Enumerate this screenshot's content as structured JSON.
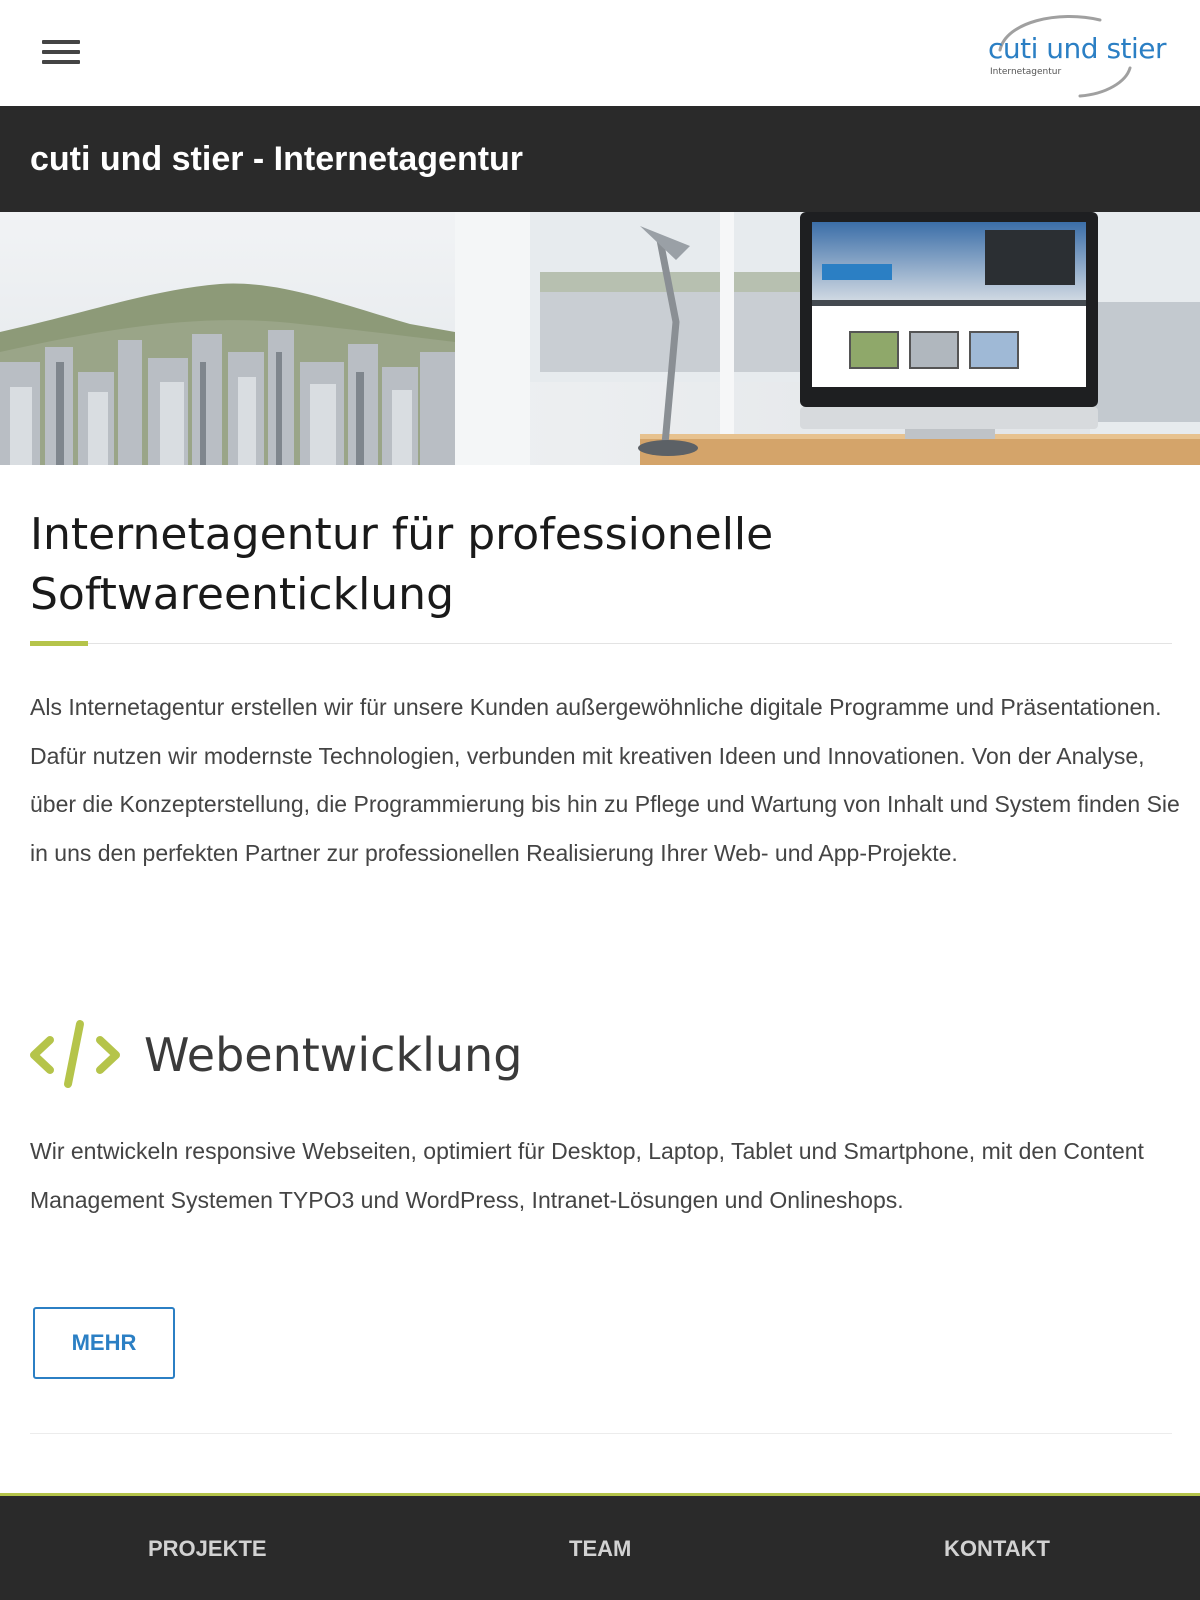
{
  "header": {
    "menu_icon": "hamburger-menu-icon",
    "logo": {
      "name": "cuti und stier",
      "tagline": "Internetagentur",
      "colors": {
        "text": "#2b7fc4",
        "swoosh": "#9a9a9a"
      }
    }
  },
  "title_bar": {
    "title": "cuti und stier - Internetagentur"
  },
  "hero": {
    "description_icon": "city-view-desk-computer-illustration"
  },
  "main": {
    "heading": "Internetagentur für professionelle Softwareenticklung",
    "intro": "Als Internetagentur erstellen wir für unsere Kunden außergewöhnliche digitale Programme und Präsentationen. Dafür nutzen wir modernste Technologien, verbunden mit kreativen Ideen und Innovationen. Von der Analyse, über die Konzepterstellung, die Programmierung bis hin zu Pflege und Wartung von Inhalt und System finden Sie in uns den perfekten Partner zur professionellen Realisierung Ihrer Web- und App-Projekte."
  },
  "section": {
    "icon": "code-brackets-icon",
    "title": "Webentwicklung",
    "text": "Wir entwickeln responsive Webseiten, optimiert für Desktop, Laptop, Tablet und Smartphone, mit den Content Management Systemen TYPO3 und WordPress, Intranet-Lösungen und Onlineshops.",
    "button_label": "MEHR"
  },
  "bottom_nav": {
    "items": [
      {
        "label": "PROJEKTE"
      },
      {
        "label": "TEAM"
      },
      {
        "label": "KONTAKT"
      }
    ]
  },
  "colors": {
    "accent": "#b5c44a",
    "brand_blue": "#2b7fc4",
    "dark_bar": "#2a2a2a",
    "text": "#444444"
  }
}
